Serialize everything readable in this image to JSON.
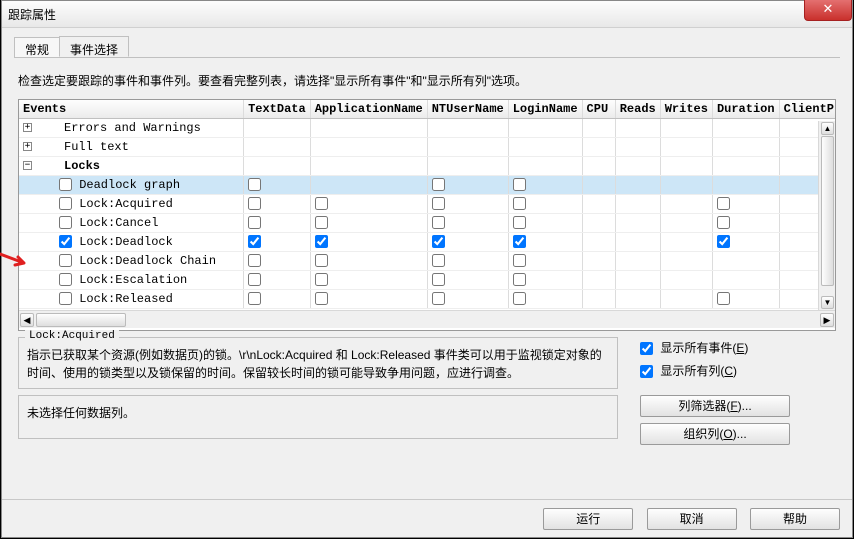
{
  "window": {
    "title": "跟踪属性"
  },
  "tabs": {
    "general": "常规",
    "event_selection": "事件选择"
  },
  "instruction": "检查选定要跟踪的事件和事件列。要查看完整列表，请选择\"显示所有事件\"和\"显示所有列\"选项。",
  "columns": [
    "Events",
    "TextData",
    "ApplicationName",
    "NTUserName",
    "LoginName",
    "CPU",
    "Reads",
    "Writes",
    "Duration",
    "ClientP"
  ],
  "rows": {
    "errors": {
      "exp": "+",
      "label": "Errors and Warnings"
    },
    "fulltext": {
      "exp": "+",
      "label": "Full text"
    },
    "locks": {
      "exp": "-",
      "label": "Locks"
    },
    "deadlock_graph": {
      "label": "Deadlock graph"
    },
    "acquired": {
      "label": "Lock:Acquired"
    },
    "cancel": {
      "label": "Lock:Cancel"
    },
    "deadlock": {
      "label": "Lock:Deadlock"
    },
    "deadlock_chain": {
      "label": "Lock:Deadlock Chain"
    },
    "escalation": {
      "label": "Lock:Escalation"
    },
    "released": {
      "label": "Lock:Released"
    }
  },
  "cells": {
    "deadlock_graph": {
      "TextData": false,
      "NTUserName": false,
      "LoginName": false
    },
    "acquired": {
      "TextData": false,
      "ApplicationName": false,
      "NTUserName": false,
      "LoginName": false,
      "Duration": false
    },
    "cancel": {
      "TextData": false,
      "ApplicationName": false,
      "NTUserName": false,
      "LoginName": false,
      "Duration": false
    },
    "deadlock": {
      "TextData": true,
      "ApplicationName": true,
      "NTUserName": true,
      "LoginName": true,
      "Duration": true
    },
    "deadlock_chain": {
      "TextData": false,
      "ApplicationName": false,
      "NTUserName": false,
      "LoginName": false
    },
    "escalation": {
      "TextData": false,
      "ApplicationName": false,
      "NTUserName": false,
      "LoginName": false
    },
    "released": {
      "TextData": false,
      "ApplicationName": false,
      "NTUserName": false,
      "LoginName": false,
      "Duration": false
    }
  },
  "row_checked": {
    "deadlock": true
  },
  "groupbox": {
    "legend": "Lock:Acquired",
    "body": "指示已获取某个资源(例如数据页)的锁。\\r\\nLock:Acquired 和 Lock:Released 事件类可以用于监视锁定对象的时间、使用的锁类型以及锁保留的时间。保留较长时间的锁可能导致争用问题，应进行调查。"
  },
  "options": {
    "show_all_events": {
      "label": "显示所有事件(",
      "hotkey": "E",
      "suf": ")",
      "checked": true
    },
    "show_all_columns": {
      "label": "显示所有列(",
      "hotkey": "C",
      "suf": ")",
      "checked": true
    }
  },
  "no_data_selected": "未选择任何数据列。",
  "buttons": {
    "column_filter": {
      "label": "列筛选器(",
      "hotkey": "F",
      "suf": ")..."
    },
    "organize_columns": {
      "label": "组织列(",
      "hotkey": "O",
      "suf": ")..."
    },
    "run": "运行",
    "cancel": "取消",
    "help": "帮助"
  }
}
